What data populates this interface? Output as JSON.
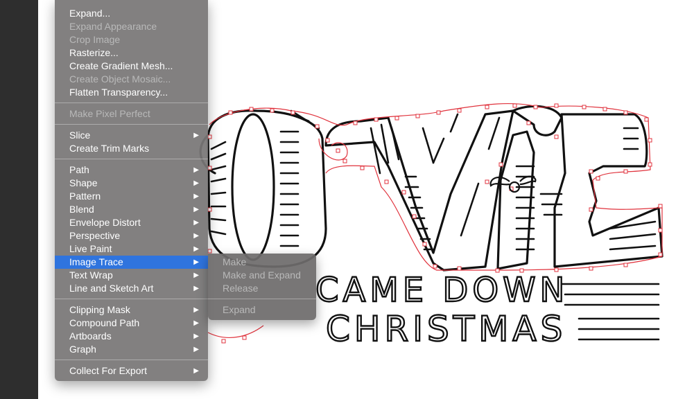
{
  "menu": {
    "groups": [
      [
        {
          "label": "Expand...",
          "enabled": true,
          "submenu": false
        },
        {
          "label": "Expand Appearance",
          "enabled": false,
          "submenu": false
        },
        {
          "label": "Crop Image",
          "enabled": false,
          "submenu": false
        },
        {
          "label": "Rasterize...",
          "enabled": true,
          "submenu": false
        },
        {
          "label": "Create Gradient Mesh...",
          "enabled": true,
          "submenu": false
        },
        {
          "label": "Create Object Mosaic...",
          "enabled": false,
          "submenu": false
        },
        {
          "label": "Flatten Transparency...",
          "enabled": true,
          "submenu": false
        }
      ],
      [
        {
          "label": "Make Pixel Perfect",
          "enabled": false,
          "submenu": false
        }
      ],
      [
        {
          "label": "Slice",
          "enabled": true,
          "submenu": true
        },
        {
          "label": "Create Trim Marks",
          "enabled": true,
          "submenu": false
        }
      ],
      [
        {
          "label": "Path",
          "enabled": true,
          "submenu": true
        },
        {
          "label": "Shape",
          "enabled": true,
          "submenu": true
        },
        {
          "label": "Pattern",
          "enabled": true,
          "submenu": true
        },
        {
          "label": "Blend",
          "enabled": true,
          "submenu": true
        },
        {
          "label": "Envelope Distort",
          "enabled": true,
          "submenu": true
        },
        {
          "label": "Perspective",
          "enabled": true,
          "submenu": true
        },
        {
          "label": "Live Paint",
          "enabled": true,
          "submenu": true
        },
        {
          "label": "Image Trace",
          "enabled": true,
          "submenu": true,
          "highlighted": true
        },
        {
          "label": "Text Wrap",
          "enabled": true,
          "submenu": true
        },
        {
          "label": "Line and Sketch Art",
          "enabled": true,
          "submenu": true
        }
      ],
      [
        {
          "label": "Clipping Mask",
          "enabled": true,
          "submenu": true
        },
        {
          "label": "Compound Path",
          "enabled": true,
          "submenu": true
        },
        {
          "label": "Artboards",
          "enabled": true,
          "submenu": true
        },
        {
          "label": "Graph",
          "enabled": true,
          "submenu": true
        }
      ],
      [
        {
          "label": "Collect For Export",
          "enabled": true,
          "submenu": true
        }
      ]
    ],
    "submenu_arrow": "▶"
  },
  "image_trace_submenu": {
    "groups": [
      [
        {
          "label": "Make",
          "enabled": false
        },
        {
          "label": "Make and Expand",
          "enabled": false
        },
        {
          "label": "Release",
          "enabled": false
        }
      ],
      [
        {
          "label": "Expand",
          "enabled": false
        }
      ]
    ]
  },
  "artwork": {
    "line1": "came down",
    "line2": "christmas",
    "stroke_color": "#111111",
    "anchor_color": "#e0323c"
  }
}
